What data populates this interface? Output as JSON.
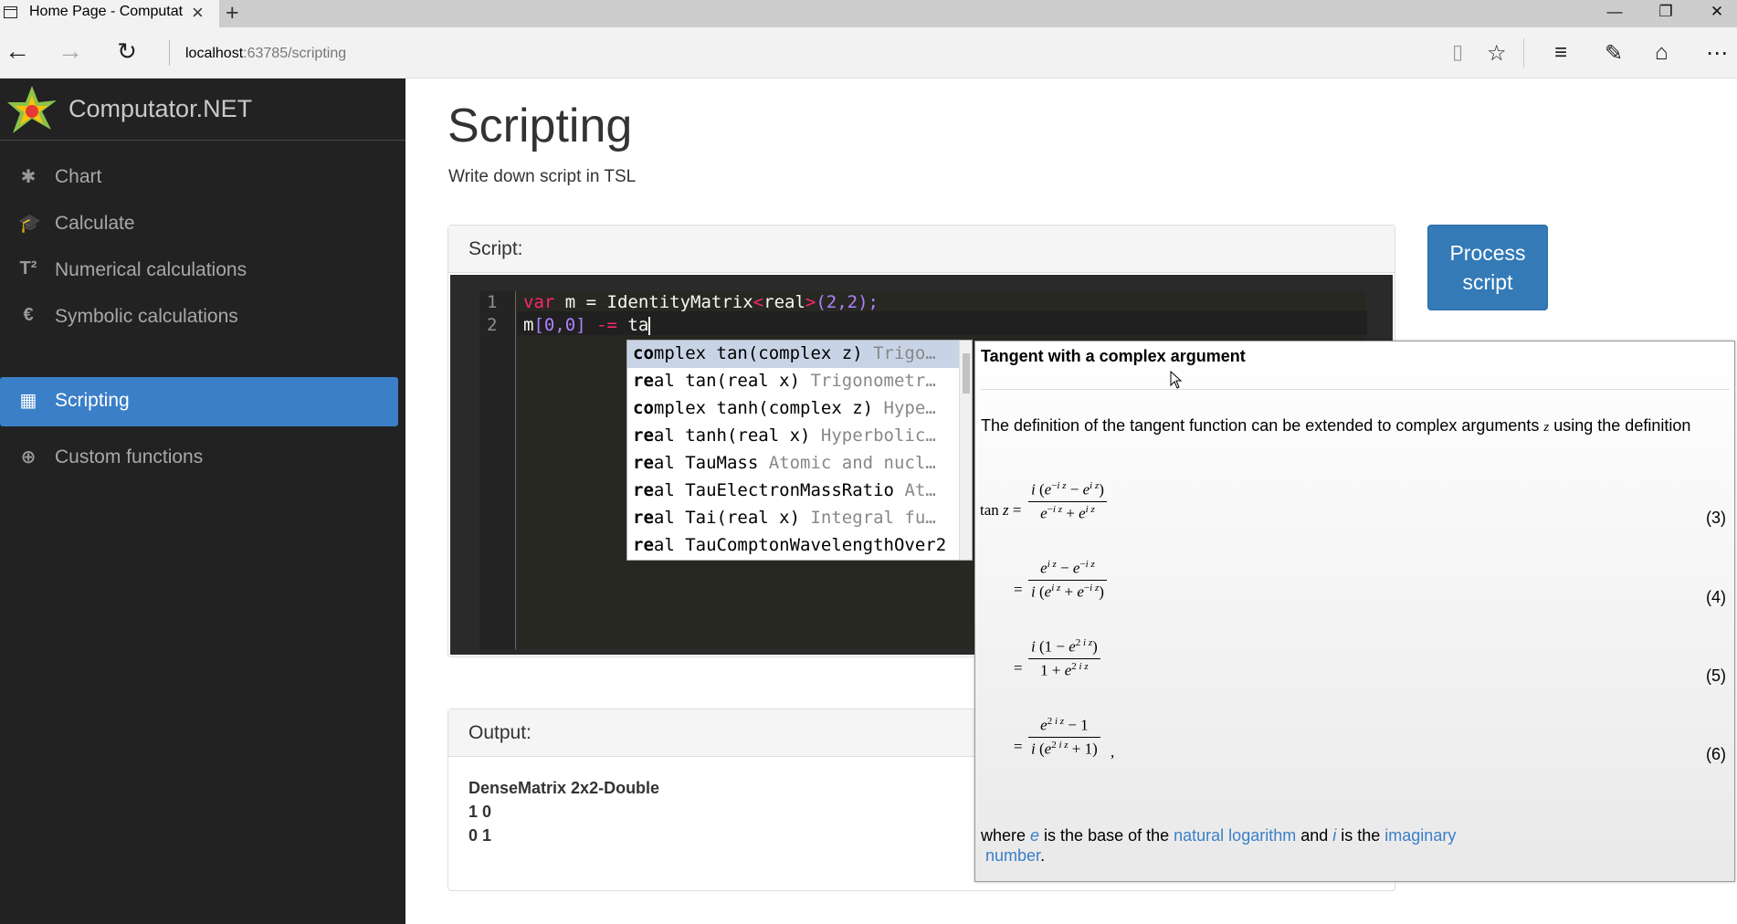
{
  "browser": {
    "tab_title": "Home Page - Computat",
    "url_host": "localhost",
    "url_path": ":63785/scripting",
    "minimize": "—",
    "maximize": "❐",
    "close": "✕"
  },
  "sidebar": {
    "brand": "Computator.NET",
    "items": [
      {
        "label": "Chart",
        "icon": "gear-icon"
      },
      {
        "label": "Calculate",
        "icon": "graduation-cap-icon"
      },
      {
        "label": "Numerical calculations",
        "icon": "text-superscript-icon"
      },
      {
        "label": "Symbolic calculations",
        "icon": "euro-icon"
      },
      {
        "label": "Scripting",
        "icon": "qrcode-icon",
        "active": true
      },
      {
        "label": "Custom functions",
        "icon": "plus-circle-icon"
      }
    ]
  },
  "main": {
    "title": "Scripting",
    "subtitle": "Write down script in TSL",
    "script_label": "Script:",
    "process_button": "Process script",
    "output_label": "Output:"
  },
  "editor": {
    "line_numbers": [
      "1",
      "2"
    ],
    "line1": {
      "kw1": "var",
      "t1": " m = IdentityMatrix",
      "kw2": "<",
      "t2": "real",
      "kw3": ">",
      "n1": "(2,2);"
    },
    "line2": {
      "t1": "m",
      "n1": "[0,0]",
      "kw1": " -= ",
      "t2": "ta"
    }
  },
  "autocomplete": {
    "items": [
      {
        "match": "co",
        "type": "mplex tan(complex z)",
        "desc": " Trigo…"
      },
      {
        "match": "re",
        "type": "al tan(real x)",
        "desc": " Trigonometr…"
      },
      {
        "match": "co",
        "type": "mplex tanh(complex z)",
        "desc": " Hype…"
      },
      {
        "match": "re",
        "type": "al tanh(real x)",
        "desc": " Hyperbolic…"
      },
      {
        "match": "re",
        "type": "al TauMass",
        "desc": " Atomic and nucl…"
      },
      {
        "match": "re",
        "type": "al TauElectronMassRatio",
        "desc": " At…"
      },
      {
        "match": "re",
        "type": "al Tai(real x)",
        "desc": " Integral fu…"
      },
      {
        "match": "re",
        "type": "al TauComptonWavelengthOver2",
        "desc": ""
      }
    ]
  },
  "tooltip": {
    "title": "Tangent with a complex argument",
    "intro_pre": "The definition of the tangent function can be extended to complex arguments ",
    "intro_var": "z",
    "intro_post": " using the definition",
    "eq_numbers": [
      "(3)",
      "(4)",
      "(5)",
      "(6)"
    ],
    "foot": {
      "p1": "where ",
      "e": "e",
      "p2": " is the base of the ",
      "link1": "natural logarithm",
      "p3": " and ",
      "i": "i",
      "p4": " is the ",
      "link2": "imaginary",
      "link3": "number",
      "p5": "."
    }
  },
  "output": {
    "title": "DenseMatrix 2x2-Double",
    "rows": [
      "1  0",
      "0  1"
    ]
  }
}
